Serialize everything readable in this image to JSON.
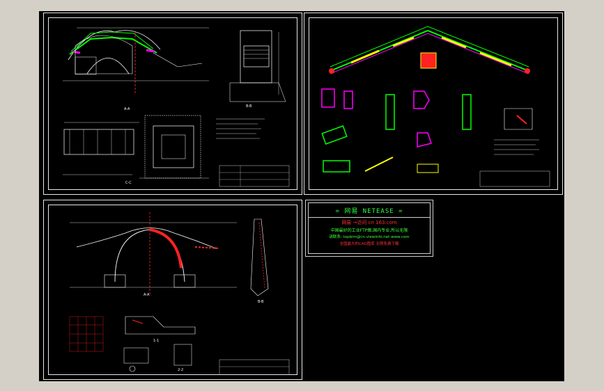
{
  "viewer": {
    "background_color": "#d4d0c8",
    "canvas_color": "#000000"
  },
  "sheets": [
    {
      "id": "sheet-stone-arch-bridge",
      "section_labels": [
        "A-A",
        "B-B",
        "C-C"
      ]
    },
    {
      "id": "sheet-bridge-railing-details",
      "section_labels": []
    },
    {
      "id": "sheet-arch-section",
      "section_labels": [
        "A-A",
        "B-B",
        "1-1",
        "2-2"
      ]
    }
  ],
  "netease": {
    "title": "= 网易  NETEASE =",
    "line1": "网易  →访问     cn 163.com",
    "line2": "中国最好的工业FTP图,国内专业,所以无限",
    "line3": "请联系: topbim@cn.viewinfo.net www.com",
    "line4": "全国最大的CAD图库 无限免费下载"
  },
  "colors": {
    "line_white": "#ffffff",
    "railing_green": "#00ff00",
    "accent_magenta": "#ff00ff",
    "accent_red": "#ff2020",
    "accent_yellow": "#ffff00",
    "accent_cyan": "#00ffff"
  }
}
